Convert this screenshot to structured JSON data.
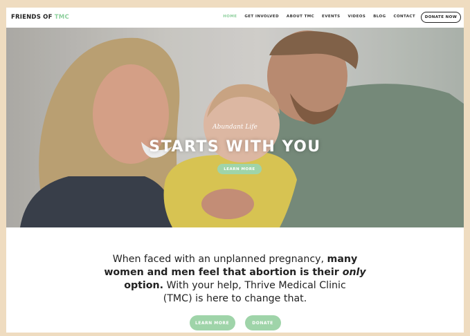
{
  "brand": {
    "name_part1": "FRIENDS OF",
    "name_part2": "TMC",
    "accent_color": "#8ccf9c"
  },
  "nav": {
    "items": [
      "HOME",
      "GET INVOLVED",
      "ABOUT TMC",
      "EVENTS",
      "VIDEOS",
      "BLOG",
      "CONTACT"
    ],
    "active": "HOME",
    "donate_label": "DONATE NOW"
  },
  "hero": {
    "script_text": "Abundant Life",
    "headline": "STARTS WITH YOU",
    "button_label": "LEARN MORE"
  },
  "mission": {
    "l1_a": "When faced with an unplanned pregnancy, ",
    "l1_b": "many",
    "l2_a": "women and men feel that abortion is their ",
    "l2_b": "only",
    "l3_a": "option.",
    "l3_b": " With your help, Thrive Medical Clinic",
    "l4": "(TMC) is here to change that.",
    "btn_learn": "LEARN MORE",
    "btn_donate": "DONATE"
  }
}
